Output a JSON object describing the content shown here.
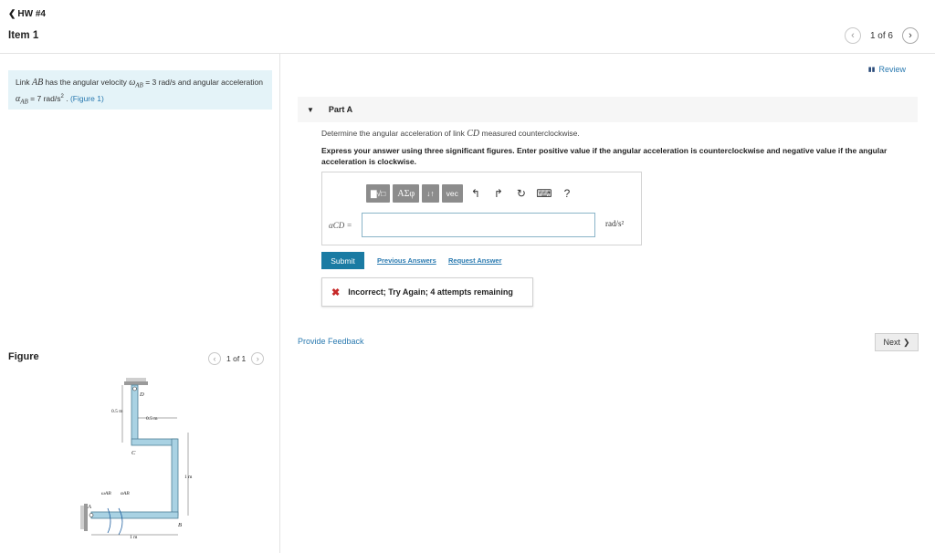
{
  "header": {
    "back_label": "HW #4",
    "item_title": "Item 1",
    "pager_text": "1 of 6"
  },
  "problem": {
    "text_prefix": "Link ",
    "link_name": "AB",
    "text_mid1": " has the angular velocity ",
    "omega_symbol": "ω",
    "omega_sub": "AB",
    "omega_value": " = 3 rad/s",
    "text_mid2": " and angular acceleration ",
    "alpha_symbol": "α",
    "alpha_sub": "AB",
    "alpha_value": " = 7 rad/s",
    "alpha_exp": "2",
    "text_end": " . ",
    "figure_link": "(Figure 1)"
  },
  "figure_panel": {
    "label": "Figure",
    "pager_text": "1 of 1",
    "labels": {
      "D": "D",
      "C": "C",
      "B": "B",
      "A": "A",
      "dim_05_vertical": "0.5 m",
      "dim_05_horizontal": "0.5 m",
      "dim_1_vertical": "1 m",
      "dim_1_horizontal": "1 m",
      "omega_label": "ωAB",
      "alpha_label": "αAB"
    }
  },
  "review_label": "Review",
  "part": {
    "title": "Part A",
    "question_prefix": "Determine the angular acceleration of link ",
    "question_link": "CD",
    "question_suffix": " measured counterclockwise.",
    "instruction": "Express your answer using three significant figures. Enter positive value if the angular acceleration is counterclockwise and negative value if the angular acceleration is clockwise."
  },
  "toolbar": {
    "template_btn": "▇√□",
    "greek_btn": "ΑΣφ",
    "sort_btn": "↓↑",
    "vec_btn": "vec",
    "undo_icon": "↰",
    "redo_icon": "↱",
    "reset_icon": "↻",
    "keyboard_icon": "⌨",
    "help_icon": "?"
  },
  "answer": {
    "label": "αCD =",
    "value": "",
    "unit": "rad/s²"
  },
  "actions": {
    "submit": "Submit",
    "previous_answers": "Previous Answers",
    "request_answer": "Request Answer"
  },
  "feedback": {
    "icon": "✖",
    "text": "Incorrect; Try Again; 4 attempts remaining"
  },
  "footer": {
    "provide_feedback": "Provide Feedback",
    "next": "Next"
  },
  "colors": {
    "accent": "#1a7ba3",
    "link": "#2a7ab0",
    "error": "#c62828",
    "problem_bg": "#e4f3f8",
    "link_fill": "#a9d2e3"
  }
}
